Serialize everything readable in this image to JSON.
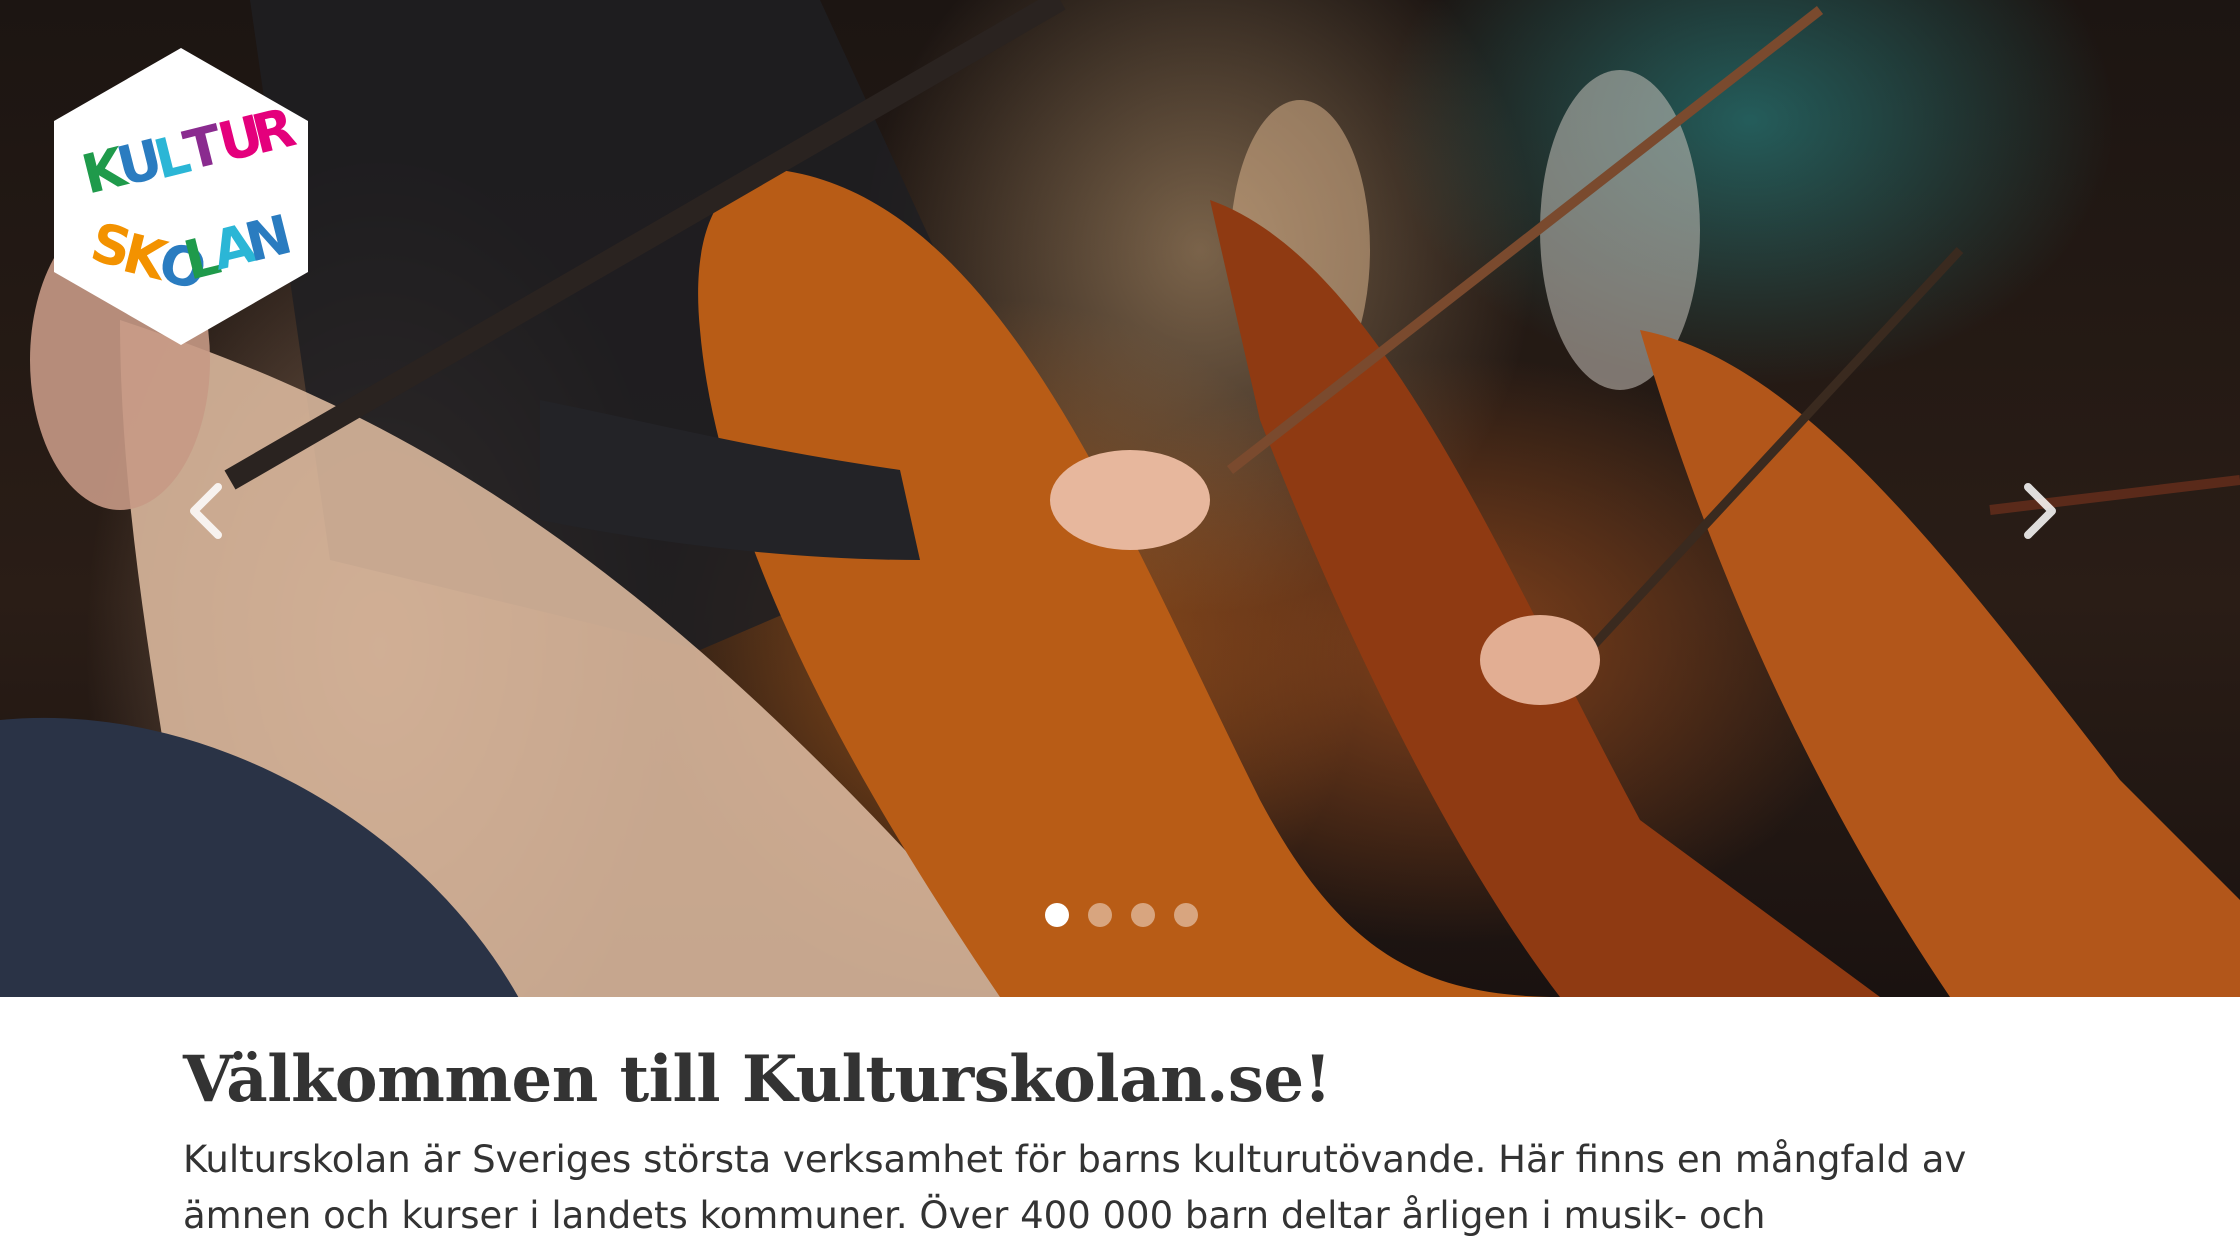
{
  "hero": {
    "logo": {
      "line1": [
        "K",
        "U",
        "L",
        "T",
        "U",
        "R"
      ],
      "line2": [
        "S",
        "K",
        "O",
        "L",
        "A",
        "N"
      ],
      "colors": [
        "#1f9a4b",
        "#2a7cc0",
        "#e4007c",
        "#8a2b8f",
        "#f39200",
        "#2bb6d6"
      ]
    },
    "prev_icon": "chevron-left-icon",
    "next_icon": "chevron-right-icon",
    "slides_total": 4,
    "active_slide": 1
  },
  "content": {
    "title": "Välkommen till Kulturskolan.se!",
    "intro": "Kulturskolan är Sveriges största verksamhet för barns kulturutövande. Här finns en mångfald av ämnen och kurser i landets kommuner. Över 400 000 barn deltar årligen i musik- och"
  }
}
